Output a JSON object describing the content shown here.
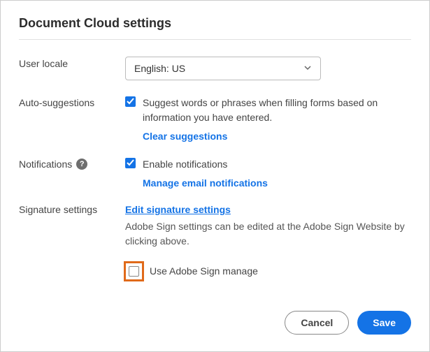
{
  "title": "Document Cloud settings",
  "locale": {
    "label": "User locale",
    "value": "English: US"
  },
  "auto_suggestions": {
    "label": "Auto-suggestions",
    "text": "Suggest words or phrases when filling forms based on information you have entered.",
    "clear_link": "Clear suggestions"
  },
  "notifications": {
    "label": "Notifications",
    "enable_text": "Enable notifications",
    "manage_link": "Manage email notifications"
  },
  "signature": {
    "label": "Signature settings",
    "edit_link": "Edit signature settings",
    "desc": "Adobe Sign settings can be edited at the Adobe Sign Website by clicking above.",
    "use_adobe_sign": "Use Adobe Sign manage"
  },
  "footer": {
    "cancel": "Cancel",
    "save": "Save"
  }
}
